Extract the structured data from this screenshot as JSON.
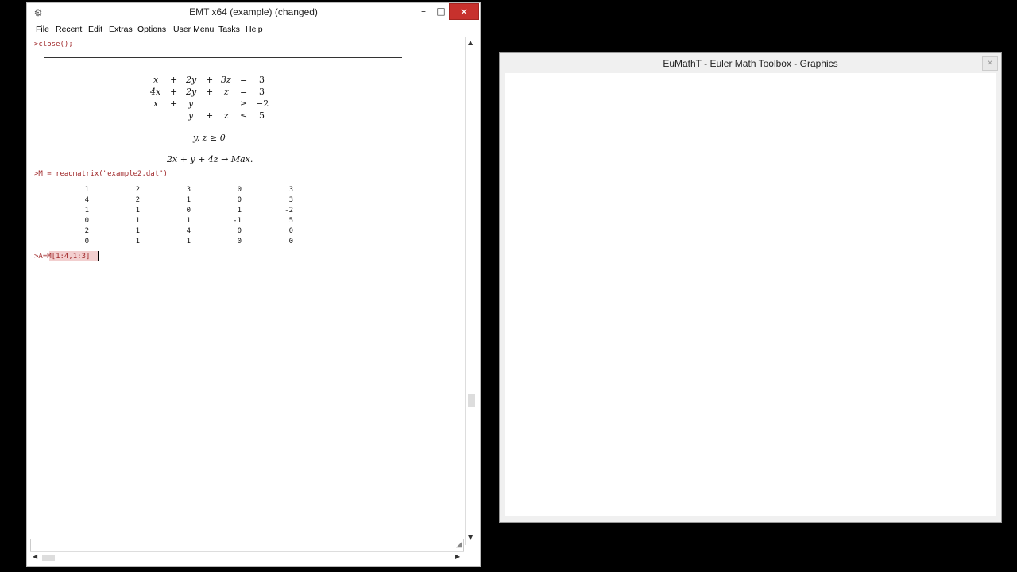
{
  "main_window": {
    "title": "EMT x64 (example) (changed)",
    "controls": {
      "minimize": "–",
      "maximize": "□",
      "close": "✕"
    },
    "menu": [
      "File",
      "Recent",
      "Edit",
      "Extras",
      "Options",
      "User Menu",
      "Tasks",
      "Help"
    ],
    "commands": {
      "close": ">close();",
      "readmatrix": ">M = readmatrix(\"example2.dat\")",
      "current_input": ">A=M[1:4,1:3]"
    },
    "lp_constraints": [
      [
        "x",
        "+",
        "2y",
        "+",
        "3z",
        "=",
        "3"
      ],
      [
        "4x",
        "+",
        "2y",
        "+",
        "z",
        "=",
        "3"
      ],
      [
        "x",
        "+",
        "y",
        "",
        "",
        "≥",
        "−2"
      ],
      [
        "",
        "",
        "y",
        "+",
        "z",
        "≤",
        "5"
      ]
    ],
    "lp_nonneg": "y, z ≥ 0",
    "lp_objective": "2x + y + 4z → Max.",
    "matrix": [
      [
        "1",
        "2",
        "3",
        "0",
        "3"
      ],
      [
        "4",
        "2",
        "1",
        "0",
        "3"
      ],
      [
        "1",
        "1",
        "0",
        "1",
        "-2"
      ],
      [
        "0",
        "1",
        "1",
        "-1",
        "5"
      ],
      [
        "2",
        "1",
        "4",
        "0",
        "0"
      ],
      [
        "0",
        "1",
        "1",
        "0",
        "0"
      ]
    ]
  },
  "graphics_window": {
    "title": "EuMathT - Euler Math Toolbox - Graphics",
    "close": "✕"
  }
}
